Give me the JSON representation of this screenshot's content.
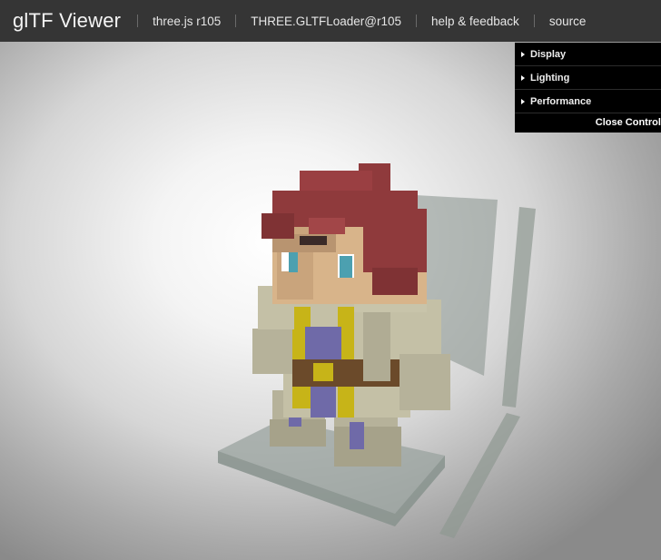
{
  "header": {
    "title": "glTF Viewer",
    "links": [
      "three.js r105",
      "THREE.GLTFLoader@r105",
      "help & feedback",
      "source"
    ]
  },
  "gui": {
    "folders": [
      "Display",
      "Lighting",
      "Performance"
    ],
    "close_label": "Close Controls"
  },
  "colors": {
    "header_bg": "#353535",
    "gui_bg": "#000000",
    "hair": "#8f3a3c",
    "skin": "#d8b48a",
    "robe": "#b8b49c",
    "gold": "#c7b418",
    "purple": "#6f6aa8",
    "brown": "#6b4a2a",
    "glass": "#a9b1ac"
  },
  "scene": {
    "model": "voxel-character-on-glass-base"
  }
}
